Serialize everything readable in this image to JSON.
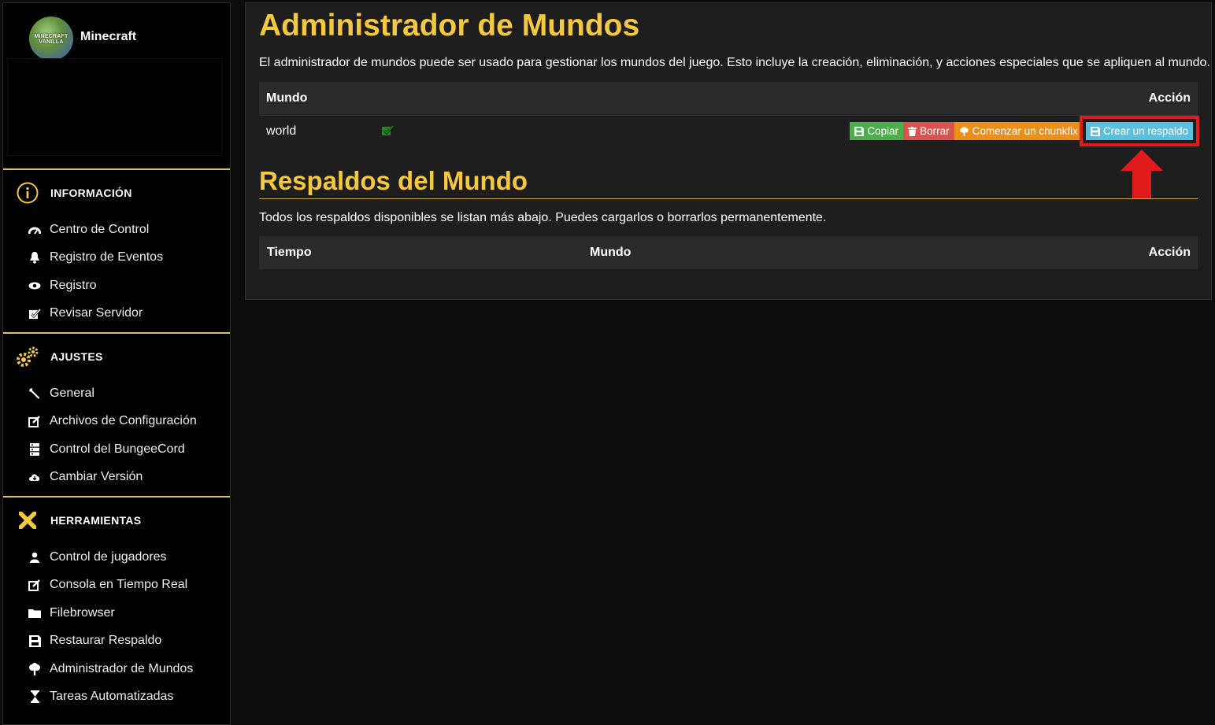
{
  "sidebar": {
    "server_name": "Minecraft",
    "avatar_text": "MINECRAFT VANILLA",
    "sections": [
      {
        "title": "INFORMACIÓN",
        "icon": "info-icon",
        "items": [
          {
            "label": "Centro de Control",
            "icon": "dashboard-icon"
          },
          {
            "label": "Registro de Eventos",
            "icon": "bell-icon"
          },
          {
            "label": "Registro",
            "icon": "eye-icon"
          },
          {
            "label": "Revisar Servidor",
            "icon": "checkbox-icon"
          }
        ]
      },
      {
        "title": "AJUSTES",
        "icon": "gears-icon",
        "items": [
          {
            "label": "General",
            "icon": "wrench-icon"
          },
          {
            "label": "Archivos de Configuración",
            "icon": "edit-icon"
          },
          {
            "label": "Control del BungeeCord",
            "icon": "server-icon"
          },
          {
            "label": "Cambiar Versión",
            "icon": "cloud-download-icon"
          }
        ]
      },
      {
        "title": "HERRAMIENTAS",
        "icon": "tools-icon",
        "items": [
          {
            "label": "Control de jugadores",
            "icon": "user-icon"
          },
          {
            "label": "Consola en Tiempo Real",
            "icon": "edit-icon"
          },
          {
            "label": "Filebrowser",
            "icon": "folder-icon"
          },
          {
            "label": "Restaurar Respaldo",
            "icon": "floppy-icon"
          },
          {
            "label": "Administrador de Mundos",
            "icon": "tree-icon"
          },
          {
            "label": "Tareas Automatizadas",
            "icon": "hourglass-icon"
          }
        ]
      }
    ]
  },
  "main": {
    "title": "Administrador de Mundos",
    "description": "El administrador de mundos puede ser usado para gestionar los mundos del juego. Esto incluye la creación, eliminación, y acciones especiales que se apliquen al mundo.",
    "worlds_table": {
      "col_world": "Mundo",
      "col_action": "Acción",
      "rows": [
        {
          "name": "world",
          "active": true
        }
      ],
      "actions": {
        "copy": "Copiar",
        "delete": "Borrar",
        "chunkfix": "Comenzar un chunkfix",
        "backup": "Crear un respaldo"
      }
    },
    "backups_title": "Respaldos del Mundo",
    "backups_description": "Todos los respaldos disponibles se listan más abajo. Puedes cargarlos o borrarlos permanentemente.",
    "backups_table": {
      "col_time": "Tiempo",
      "col_world": "Mundo",
      "col_action": "Acción"
    }
  },
  "colors": {
    "accent": "#f5c842",
    "copy": "#4cae4c",
    "delete": "#d9534f",
    "chunkfix": "#ec8f1a",
    "backup": "#5bc0de",
    "highlight": "#e11b1b"
  }
}
